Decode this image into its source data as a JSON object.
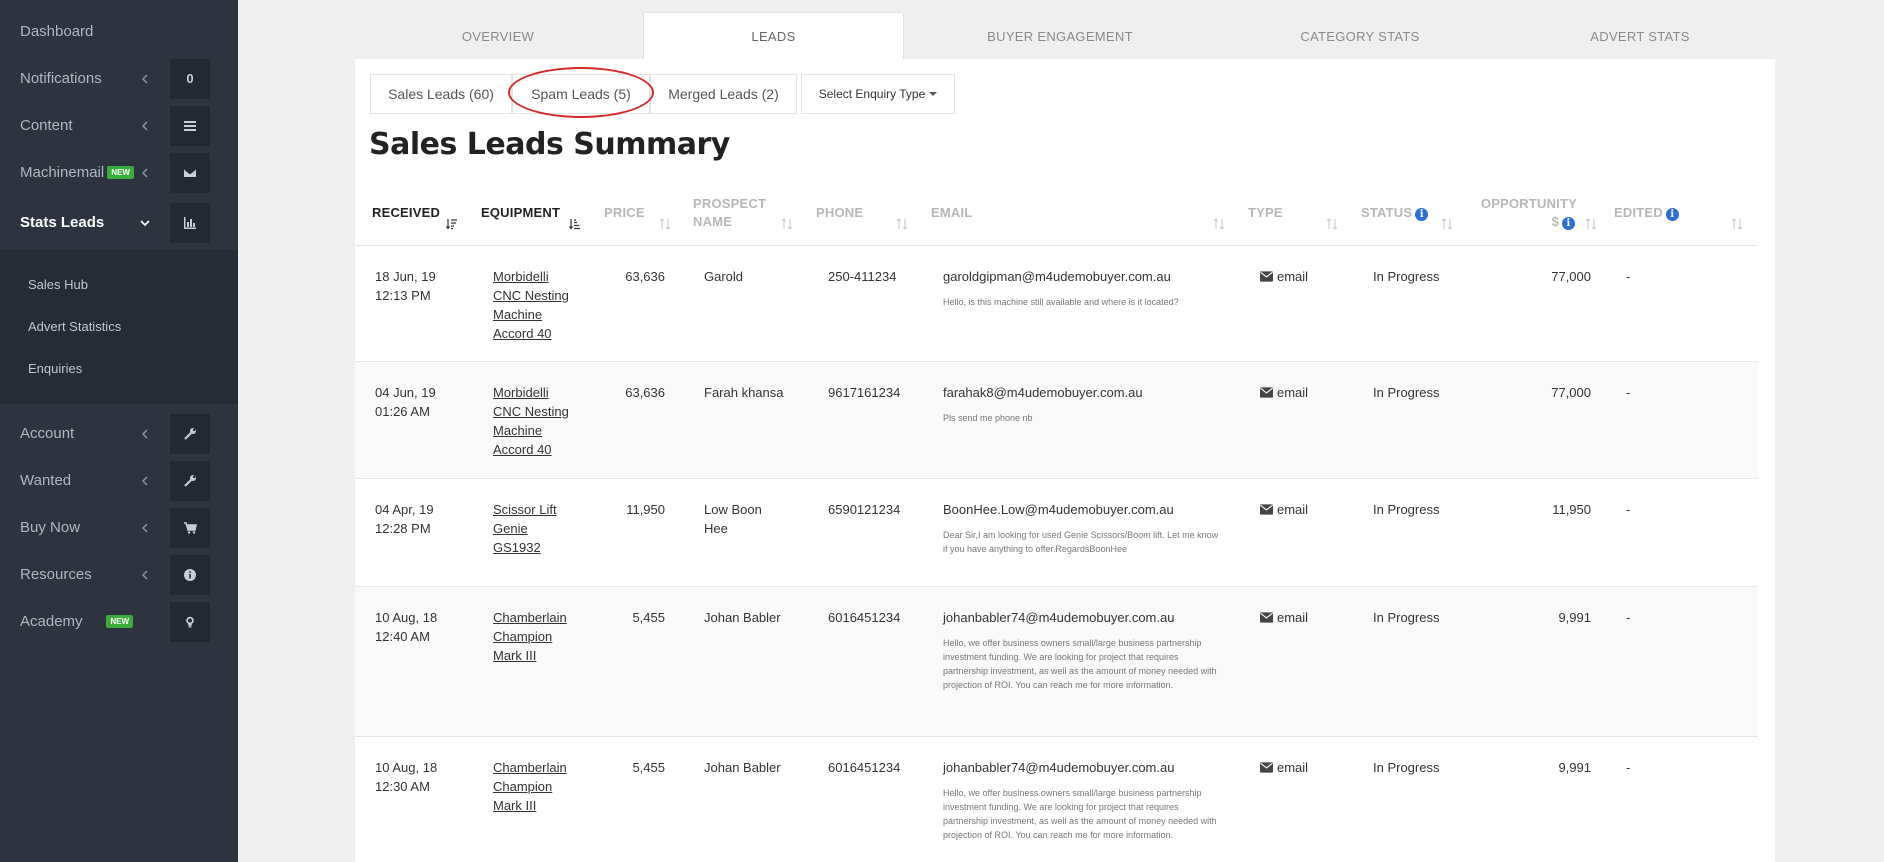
{
  "sidebar": {
    "items": [
      {
        "label": "Dashboard"
      },
      {
        "label": "Notifications",
        "count": "0"
      },
      {
        "label": "Content"
      },
      {
        "label": "Machinemail",
        "badge": "NEW"
      },
      {
        "label": "Stats Leads"
      },
      {
        "label": "Account"
      },
      {
        "label": "Wanted"
      },
      {
        "label": "Buy Now"
      },
      {
        "label": "Resources"
      },
      {
        "label": "Academy",
        "badge": "NEW"
      }
    ],
    "subitems": [
      "Sales Hub",
      "Advert Statistics",
      "Enquiries"
    ]
  },
  "top_tabs": [
    "OVERVIEW",
    "LEADS",
    "BUYER ENGAGEMENT",
    "CATEGORY STATS",
    "ADVERT STATS"
  ],
  "sub_tabs": {
    "sales": "Sales Leads (60)",
    "spam": "Spam Leads (5)",
    "merged": "Merged Leads (2)",
    "enquiry_type": "Select Enquiry Type"
  },
  "page_title": "Sales Leads Summary",
  "columns": {
    "received": "RECEIVED",
    "equipment": "EQUIPMENT",
    "price": "PRICE",
    "prospect_1": "PROSPECT",
    "prospect_2": "NAME",
    "phone": "PHONE",
    "email": "EMAIL",
    "type": "TYPE",
    "status": "STATUS",
    "opportunity_1": "OPPORTUNITY",
    "opportunity_2": "$",
    "edited": "EDITED"
  },
  "rows": [
    {
      "date": "18 Jun, 19",
      "time": "12:13 PM",
      "equipment": [
        "Morbidelli",
        "CNC Nesting",
        "Machine",
        "Accord 40"
      ],
      "price": "63,636",
      "name": [
        "Garold"
      ],
      "phone": "250-411234",
      "email": "garoldgipman@m4udemobuyer.com.au",
      "message": "Hello, is this machine still available and where is it located?",
      "type": "email",
      "status": "In Progress",
      "opportunity": "77,000",
      "edited": "-"
    },
    {
      "date": "04 Jun, 19",
      "time": "01:26 AM",
      "equipment": [
        "Morbidelli",
        "CNC Nesting",
        "Machine",
        "Accord 40"
      ],
      "price": "63,636",
      "name": [
        "Farah khansa"
      ],
      "phone": "9617161234",
      "email": "farahak8@m4udemobuyer.com.au",
      "message": "Pls send me phone nb",
      "type": "email",
      "status": "In Progress",
      "opportunity": "77,000",
      "edited": "-"
    },
    {
      "date": "04 Apr, 19",
      "time": "12:28 PM",
      "equipment": [
        "Scissor Lift",
        "Genie",
        "GS1932"
      ],
      "price": "11,950",
      "name": [
        "Low Boon",
        "Hee"
      ],
      "phone": "6590121234",
      "email": "BoonHee.Low@m4udemobuyer.com.au",
      "message": "Dear Sir,I am looking for used Genie Scissors/Boom lift. Let me know if you have anything to offer.RegardsBoonHee",
      "type": "email",
      "status": "In Progress",
      "opportunity": "11,950",
      "edited": "-"
    },
    {
      "date": "10 Aug, 18",
      "time": "12:40 AM",
      "equipment": [
        "Chamberlain",
        "Champion",
        "Mark III"
      ],
      "price": "5,455",
      "name": [
        "Johan Babler"
      ],
      "phone": "6016451234",
      "email": "johanbabler74@m4udemobuyer.com.au",
      "message": "Hello, we offer business owners small/large business partnership investment funding. We are looking for project that requires partnership investment, as well as the amount of money needed with projection of ROI. You can reach me for more information.",
      "type": "email",
      "status": "In Progress",
      "opportunity": "9,991",
      "edited": "-"
    },
    {
      "date": "10 Aug, 18",
      "time": "12:30 AM",
      "equipment": [
        "Chamberlain",
        "Champion",
        "Mark III"
      ],
      "price": "5,455",
      "name": [
        "Johan Babler"
      ],
      "phone": "6016451234",
      "email": "johanbabler74@m4udemobuyer.com.au",
      "message": "Hello, we offer business owners small/large business partnership investment funding. We are looking for project that requires partnership investment, as well as the amount of money needed with projection of ROI. You can reach me for more information.",
      "type": "email",
      "status": "In Progress",
      "opportunity": "9,991",
      "edited": "-"
    }
  ]
}
